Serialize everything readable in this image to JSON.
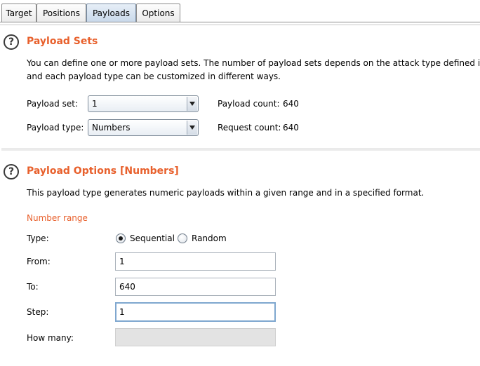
{
  "tabs": [
    {
      "label": "Target"
    },
    {
      "label": "Positions"
    },
    {
      "label": "Payloads"
    },
    {
      "label": "Options"
    }
  ],
  "active_tab": "Payloads",
  "payload_sets": {
    "title": "Payload Sets",
    "description_line1": "You can define one or more payload sets. The number of payload sets depends on the attack type defined in the",
    "description_line2": "and each payload type can be customized in different ways.",
    "payload_set_label": "Payload set:",
    "payload_set_value": "1",
    "payload_type_label": "Payload type:",
    "payload_type_value": "Numbers",
    "payload_count_label": "Payload count:",
    "payload_count_value": "640",
    "request_count_label": "Request count:",
    "request_count_value": "640"
  },
  "payload_options": {
    "title": "Payload Options [Numbers]",
    "description": "This payload type generates numeric payloads within a given range and in a specified format.",
    "number_range_heading": "Number range",
    "type_label": "Type:",
    "type_options": [
      "Sequential",
      "Random"
    ],
    "type_selected": "Sequential",
    "from_label": "From:",
    "from_value": "1",
    "to_label": "To:",
    "to_value": "640",
    "step_label": "Step:",
    "step_value": "1",
    "how_many_label": "How many:",
    "how_many_value": ""
  },
  "colors": {
    "accent": "#e8602c",
    "active_tab": "#c9d9ea",
    "focus_border": "#7fa7cf"
  }
}
